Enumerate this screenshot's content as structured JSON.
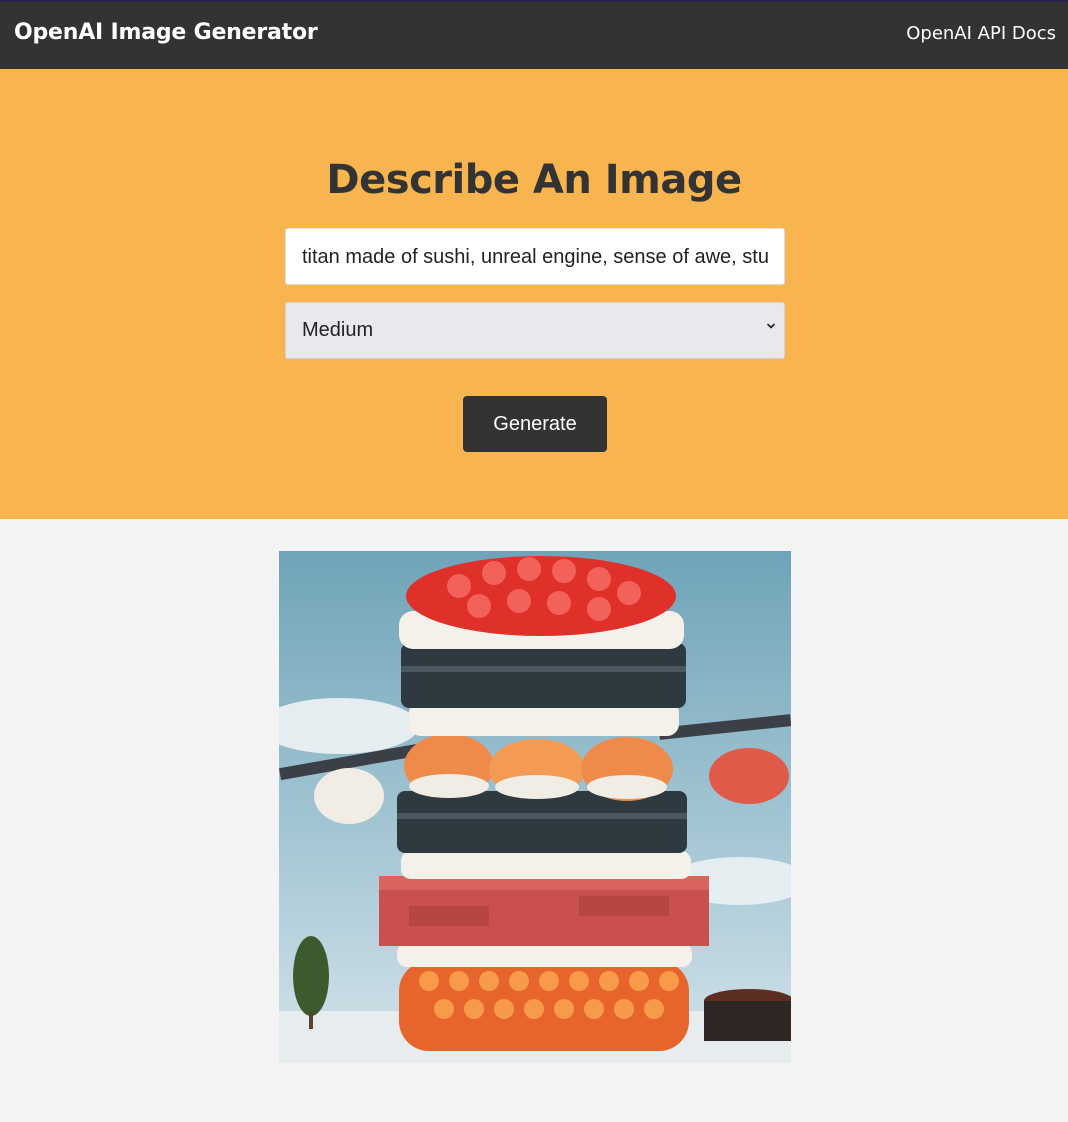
{
  "navbar": {
    "brand": "OpenAI Image Generator",
    "docs_link": "OpenAI API Docs"
  },
  "hero": {
    "title": "Describe An Image",
    "prompt_value": "titan made of sushi, unreal engine, sense of awe, stu",
    "size_selected": "Medium",
    "generate_label": "Generate"
  },
  "colors": {
    "navbar_bg": "#333333",
    "hero_bg": "#f8b54f",
    "page_bg": "#f3f3f3",
    "button_bg": "#333333"
  },
  "result": {
    "image_subject": "sushi-titan-image"
  }
}
